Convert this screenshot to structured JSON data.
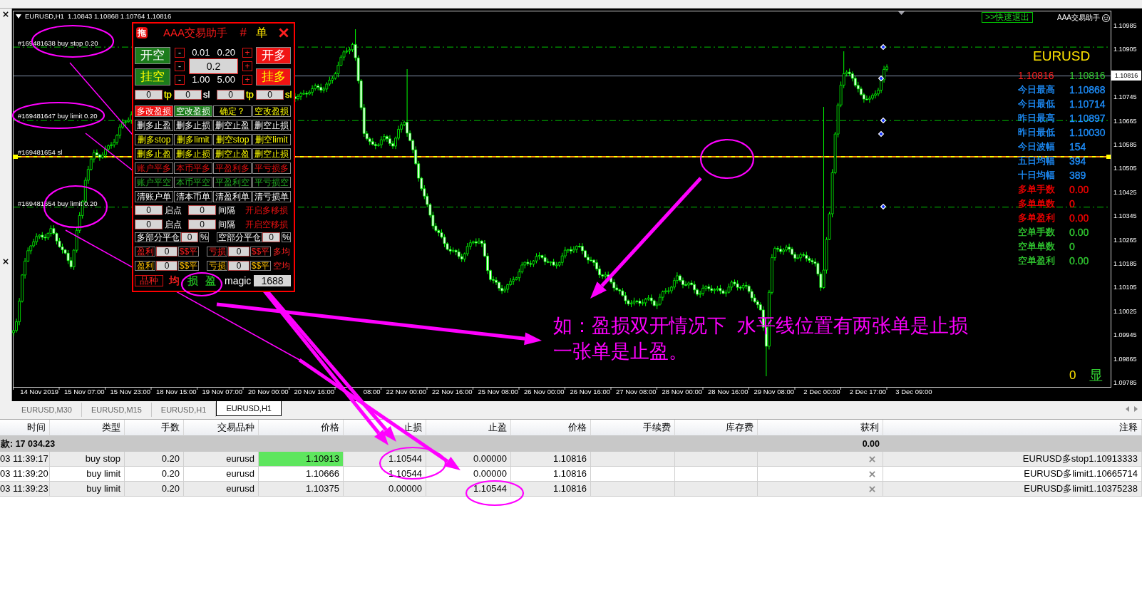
{
  "chart": {
    "title": "EURUSD,H1",
    "ohlc": "1.10843 1.10868 1.10764 1.10816",
    "order_labels": [
      "#169481638 buy stop 0.20",
      "#169481647 buy limit 0.20",
      "#169481654 sl",
      "#169481654 buy limit 0.20"
    ],
    "price_axis": [
      "1.10985",
      "1.10905",
      "1.10745",
      "1.10665",
      "1.10585",
      "1.10505",
      "1.10425",
      "1.10345",
      "1.10265",
      "1.10185",
      "1.10105",
      "1.10025",
      "1.09945",
      "1.09865",
      "1.09785"
    ],
    "bid_price": "1.10816",
    "time_axis": [
      "14 Nov 2019",
      "15 Nov 07:00",
      "15 Nov 23:00",
      "18 Nov 15:00",
      "19 Nov 07:00",
      "20 Nov 00:00",
      "20 Nov 16:00",
      "08:00",
      "22 Nov 00:00",
      "22 Nov 16:00",
      "25 Nov 08:00",
      "26 Nov 00:00",
      "26 Nov 16:00",
      "27 Nov 08:00",
      "28 Nov 00:00",
      "28 Nov 16:00",
      "29 Nov 08:00",
      "2 Dec 00:00",
      "2 Dec 17:00",
      "3 Dec 09:00"
    ],
    "quick_exit": ">>快速退出",
    "ea_name": "AAA交易助手",
    "market_info": {
      "symbol": "EURUSD",
      "bid": "1.10816",
      "ask": "1.10816",
      "rows": [
        {
          "label": "今日最高",
          "value": "1.10868",
          "color": "#1e90ff"
        },
        {
          "label": "今日最低",
          "value": "1.10714",
          "color": "#1e90ff"
        },
        {
          "label": "昨日最高",
          "value": "1.10897",
          "color": "#1e90ff"
        },
        {
          "label": "昨日最低",
          "value": "1.10030",
          "color": "#1e90ff"
        },
        {
          "label": "今日波幅",
          "value": "154",
          "color": "#1e90ff"
        },
        {
          "label": "五日均幅",
          "value": "394",
          "color": "#1e90ff"
        },
        {
          "label": "十日均幅",
          "value": "389",
          "color": "#1e90ff"
        },
        {
          "label": "多单手数",
          "value": "0.00",
          "color": "#ff0000"
        },
        {
          "label": "多单单数",
          "value": "0",
          "color": "#ff0000"
        },
        {
          "label": "多单盈利",
          "value": "0.00",
          "color": "#ff0000"
        },
        {
          "label": "空单手数",
          "value": "0.00",
          "color": "#32cd32"
        },
        {
          "label": "空单单数",
          "value": "0",
          "color": "#32cd32"
        },
        {
          "label": "空单盈利",
          "value": "0.00",
          "color": "#32cd32"
        }
      ]
    },
    "counter": "0",
    "toggle": "显",
    "note": "如：盈损双开情况下  水平线位置有两张单是止损一张单是止盈。"
  },
  "panel": {
    "drag_label": "拖",
    "title": "AAA交易助手",
    "hash": "#",
    "order_label": "单",
    "left_buttons": [
      {
        "label": "开空",
        "kind": "market"
      },
      {
        "label": "挂空",
        "kind": "pending"
      }
    ],
    "lot_rows": [
      {
        "minus": "-",
        "values": [
          "0.01",
          "0.20"
        ],
        "plus": "+"
      },
      {
        "minus": "-",
        "field": "0.2",
        "plus": "+"
      },
      {
        "minus": "-",
        "values": [
          "1.00",
          "5.00"
        ],
        "plus": "+"
      }
    ],
    "right_buttons": [
      {
        "label": "开多",
        "kind": "market"
      },
      {
        "label": "挂多",
        "kind": "pending"
      }
    ],
    "sltp": [
      {
        "kind": "field",
        "value": "0"
      },
      {
        "kind": "label",
        "text": "tp",
        "color": "#ffff00"
      },
      {
        "kind": "field",
        "value": "0"
      },
      {
        "kind": "label",
        "text": "sl",
        "color": "#ffffff"
      },
      {
        "kind": "field",
        "value": "0"
      },
      {
        "kind": "label",
        "text": "tp",
        "color": "#ffff00"
      },
      {
        "kind": "field",
        "value": "0"
      },
      {
        "kind": "label",
        "text": "sl",
        "color": "#ffff00"
      }
    ],
    "grid": [
      {
        "label": "多改盈损",
        "kind": "danger"
      },
      {
        "label": "空改盈损",
        "kind": "success"
      },
      {
        "label": "确定？",
        "kind": "warning"
      },
      {
        "label": "空改盈损",
        "kind": "warning"
      },
      {
        "label": "删多止盈",
        "kind": "plain"
      },
      {
        "label": "删多止损",
        "kind": "plain"
      },
      {
        "label": "删空止盈",
        "kind": "plain"
      },
      {
        "label": "删空止损",
        "kind": "plain"
      },
      {
        "label": "删多stop",
        "kind": "warning"
      },
      {
        "label": "删多limit",
        "kind": "warning"
      },
      {
        "label": "删空stop",
        "kind": "warning"
      },
      {
        "label": "删空limit",
        "kind": "warning"
      },
      {
        "label": "删多止盈",
        "kind": "warning"
      },
      {
        "label": "删多止损",
        "kind": "warning"
      },
      {
        "label": "删空止盈",
        "kind": "warning"
      },
      {
        "label": "删空止损",
        "kind": "warning"
      },
      {
        "label": "账户平多",
        "kind": "long"
      },
      {
        "label": "本币平多",
        "kind": "long"
      },
      {
        "label": "平盈利多",
        "kind": "long"
      },
      {
        "label": "平亏损多",
        "kind": "long"
      },
      {
        "label": "账户平空",
        "kind": "short"
      },
      {
        "label": "本币平空",
        "kind": "short"
      },
      {
        "label": "平盈利空",
        "kind": "short"
      },
      {
        "label": "平亏损空",
        "kind": "short"
      },
      {
        "label": "清账户单",
        "kind": "plain"
      },
      {
        "label": "清本币单",
        "kind": "plain"
      },
      {
        "label": "清盈利单",
        "kind": "plain"
      },
      {
        "label": "清亏损单",
        "kind": "plain"
      }
    ],
    "trailing": [
      {
        "start": "0",
        "start_label": "启点",
        "step": "0",
        "step_label": "间隔",
        "action": "开启多移损"
      },
      {
        "start": "0",
        "start_label": "启点",
        "step": "0",
        "step_label": "间隔",
        "action": "开启空移损"
      }
    ],
    "partial_close": [
      {
        "label": "多部分平仓",
        "value": "0",
        "unit": "%"
      },
      {
        "label": "空部分平仓",
        "value": "0",
        "unit": "%"
      }
    ],
    "money_close": [
      {
        "profit_label": "盈利",
        "profit_value": "0",
        "profit_button": "$$平",
        "loss_label": "亏损",
        "loss_value": "0",
        "loss_button": "$$平",
        "average": "多均",
        "kind": "long"
      },
      {
        "profit_label": "盈利",
        "profit_value": "0",
        "profit_button": "$$平",
        "loss_label": "亏损",
        "loss_value": "0",
        "loss_button": "$$平",
        "average": "空均",
        "kind": "short"
      }
    ],
    "symbol_button": "品种",
    "markers": [
      {
        "label": "均",
        "color": "#ff2020"
      },
      {
        "label": "损",
        "color": "#22bb22"
      },
      {
        "label": "盈",
        "color": "#22bb22"
      }
    ],
    "magic_label": "magic",
    "magic_value": "1688"
  },
  "chart_tabs": [
    {
      "label": "EURUSD,M30",
      "selected": false
    },
    {
      "label": "EURUSD,M15",
      "selected": false
    },
    {
      "label": "EURUSD,H1",
      "selected": false
    },
    {
      "label": "EURUSD,H1",
      "selected": true
    }
  ],
  "terminal": {
    "columns": [
      "时间",
      "类型",
      "手数",
      "交易品种",
      "价格",
      "止损",
      "止盈",
      "价格",
      "手续费",
      "库存费",
      "获利",
      "注释"
    ],
    "summary": {
      "balance": "款: 17 034.23",
      "profit": "0.00"
    },
    "rows": [
      {
        "time": "03 11:39:17",
        "type": "buy stop",
        "lots": "0.20",
        "symbol": "eurusd",
        "price": "1.10913",
        "sl": "1.10544",
        "tp": "0.00000",
        "current": "1.10816",
        "comment": "EURUSD多stop1.10913333",
        "highlighted": true
      },
      {
        "time": "03 11:39:20",
        "type": "buy limit",
        "lots": "0.20",
        "symbol": "eurusd",
        "price": "1.10666",
        "sl": "1.10544",
        "tp": "0.00000",
        "current": "1.10816",
        "comment": "EURUSD多limit1.10665714",
        "highlighted": false
      },
      {
        "time": "03 11:39:23",
        "type": "buy limit",
        "lots": "0.20",
        "symbol": "eurusd",
        "price": "1.10375",
        "sl": "0.00000",
        "tp": "1.10544",
        "current": "1.10816",
        "comment": "EURUSD多limit1.10375238",
        "highlighted": false
      }
    ]
  }
}
